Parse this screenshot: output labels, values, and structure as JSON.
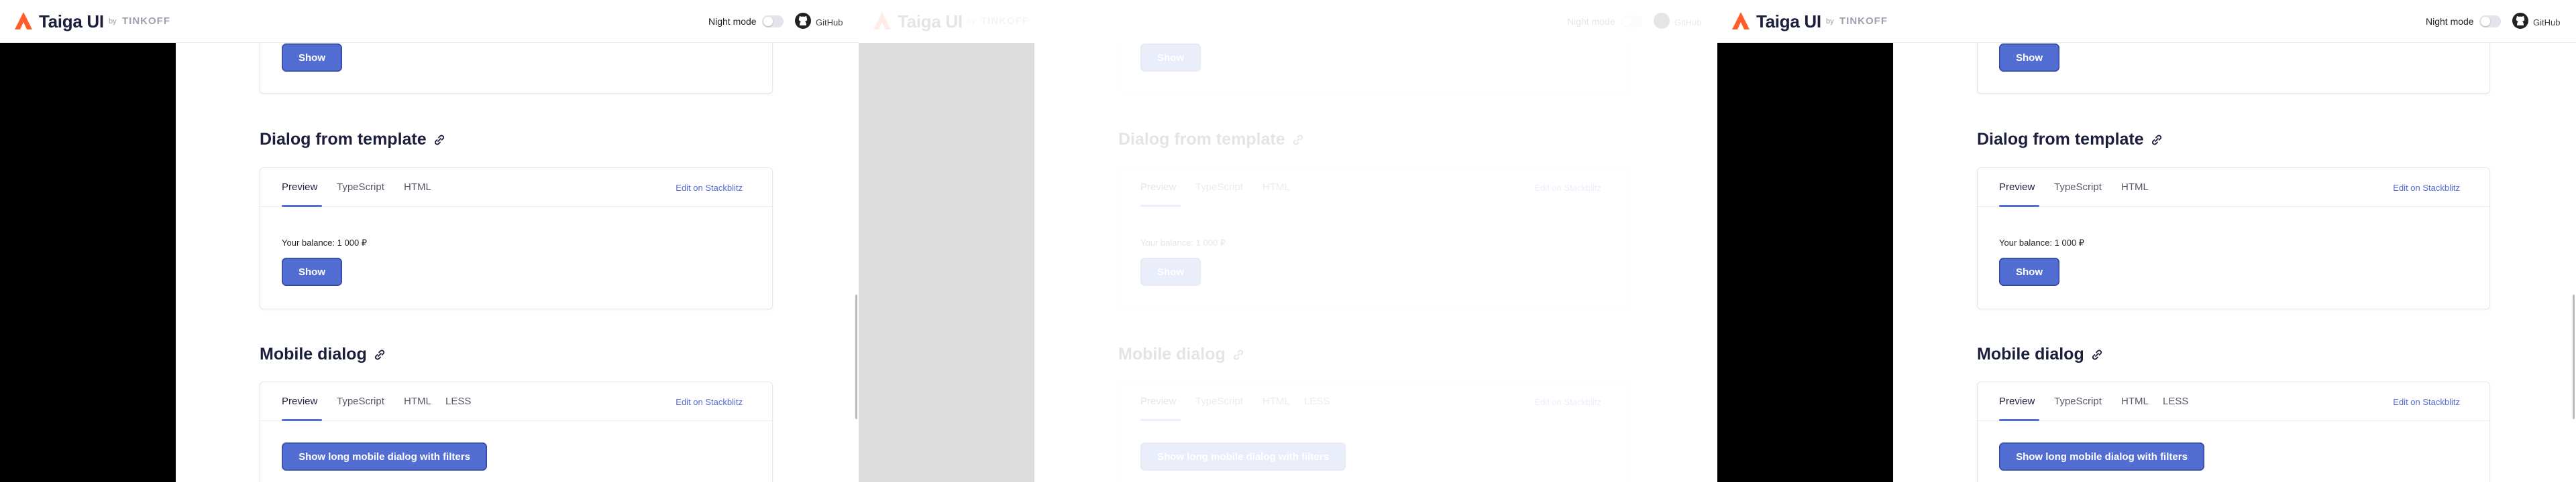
{
  "header": {
    "brand": "Taiga UI",
    "by": "by",
    "company": "TINKOFF",
    "night_mode_label": "Night mode",
    "github_label": "GitHub"
  },
  "sections": {
    "top_button_label": "Show",
    "dialog_template": {
      "title": "Dialog from template",
      "tabs": [
        "Preview",
        "TypeScript",
        "HTML"
      ],
      "edit_link": "Edit on Stackblitz",
      "balance_text": "Your balance: 1 000 ₽",
      "button_label": "Show"
    },
    "mobile_dialog": {
      "title": "Mobile dialog",
      "tabs": [
        "Preview",
        "TypeScript",
        "HTML",
        "LESS"
      ],
      "edit_link": "Edit on Stackblitz",
      "button_label": "Show long mobile dialog with filters"
    }
  },
  "colors": {
    "accent": "#526ed3",
    "brand_orange": "#ff5e2a",
    "text_dark": "#1b1f3b"
  },
  "icons": [
    "taiga-logo-icon",
    "github-icon",
    "link-icon"
  ]
}
